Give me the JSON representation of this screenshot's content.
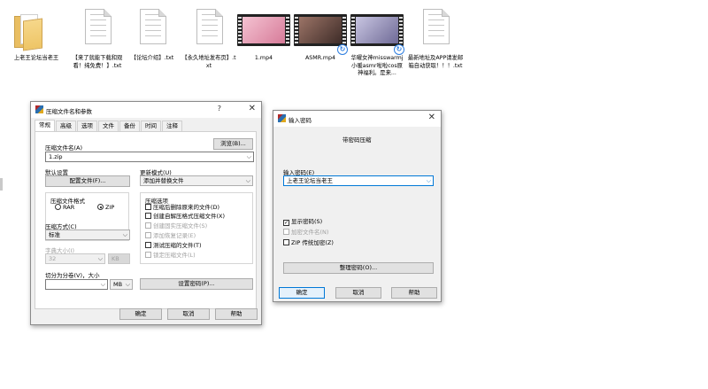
{
  "desktop": {
    "files": [
      {
        "name": "上老王论坛当老王",
        "type": "folder"
      },
      {
        "name": "【来了就能下载和观看！纯免费！】.txt",
        "type": "txt"
      },
      {
        "name": "【论坛介绍】.txt",
        "type": "txt"
      },
      {
        "name": "【永久地址发布页】.txt",
        "type": "txt"
      },
      {
        "name": "1.mp4",
        "type": "video",
        "thumb": "#e7a0b6"
      },
      {
        "name": "ASMR.mp4",
        "type": "video",
        "thumb": "#7c5a52"
      },
      {
        "name": "华曜女神misswarmj小暖asmr啦啦cos原神福利。是来...",
        "type": "video",
        "thumb": "#a7a3c6"
      },
      {
        "name": "最新地址及APP请发邮箱自动获取！！！.txt",
        "type": "txt"
      }
    ]
  },
  "archive_dialog": {
    "title": "压缩文件名和参数",
    "help_glyph": "?",
    "close_glyph": "✕",
    "tabs": [
      "常规",
      "高级",
      "选项",
      "文件",
      "备份",
      "时间",
      "注释"
    ],
    "archive_name_label": "压缩文件名(A)",
    "browse_button": "浏览(B)...",
    "archive_name_value": "1.zip",
    "default_settings_label": "默认设置",
    "profiles_button": "配置文件(F)...",
    "update_mode_label": "更新模式(U)",
    "update_mode_value": "添加并替换文件",
    "format_group": "压缩文件格式",
    "format_rar": "RAR",
    "format_zip": "ZIP",
    "options_group": "压缩选项",
    "options": [
      {
        "label": "压缩后删除原来的文件(D)",
        "checked": false,
        "enabled": true
      },
      {
        "label": "创建自解压格式压缩文件(X)",
        "checked": false,
        "enabled": true
      },
      {
        "label": "创建固实压缩文件(S)",
        "checked": false,
        "enabled": false
      },
      {
        "label": "添加恢复记录(E)",
        "checked": false,
        "enabled": false
      },
      {
        "label": "测试压缩的文件(T)",
        "checked": false,
        "enabled": true
      },
      {
        "label": "锁定压缩文件(L)",
        "checked": false,
        "enabled": false
      }
    ],
    "method_label": "压缩方式(C)",
    "method_value": "标准",
    "dict_label": "字典大小(I)",
    "dict_value": "32",
    "dict_unit": "KB",
    "split_label": "切分为分卷(V)，大小",
    "split_value": "",
    "split_unit": "MB",
    "set_password_button": "设置密码(P)...",
    "ok_button": "确定",
    "cancel_button": "取消",
    "help_button": "帮助"
  },
  "password_dialog": {
    "title": "输入密码",
    "close_glyph": "✕",
    "heading": "带密码压缩",
    "password_label": "输入密码(E)",
    "password_value": "上老王论坛当老王",
    "show_password": "显示密码(S)",
    "encrypt_names": "加密文件名(N)",
    "zip_legacy": "ZIP 传统加密(Z)",
    "organize_button": "整理密码(O)...",
    "ok_button": "确定",
    "cancel_button": "取消",
    "help_button": "帮助"
  },
  "colors": {
    "accent": "#0078d7",
    "folder": "#eec566"
  }
}
